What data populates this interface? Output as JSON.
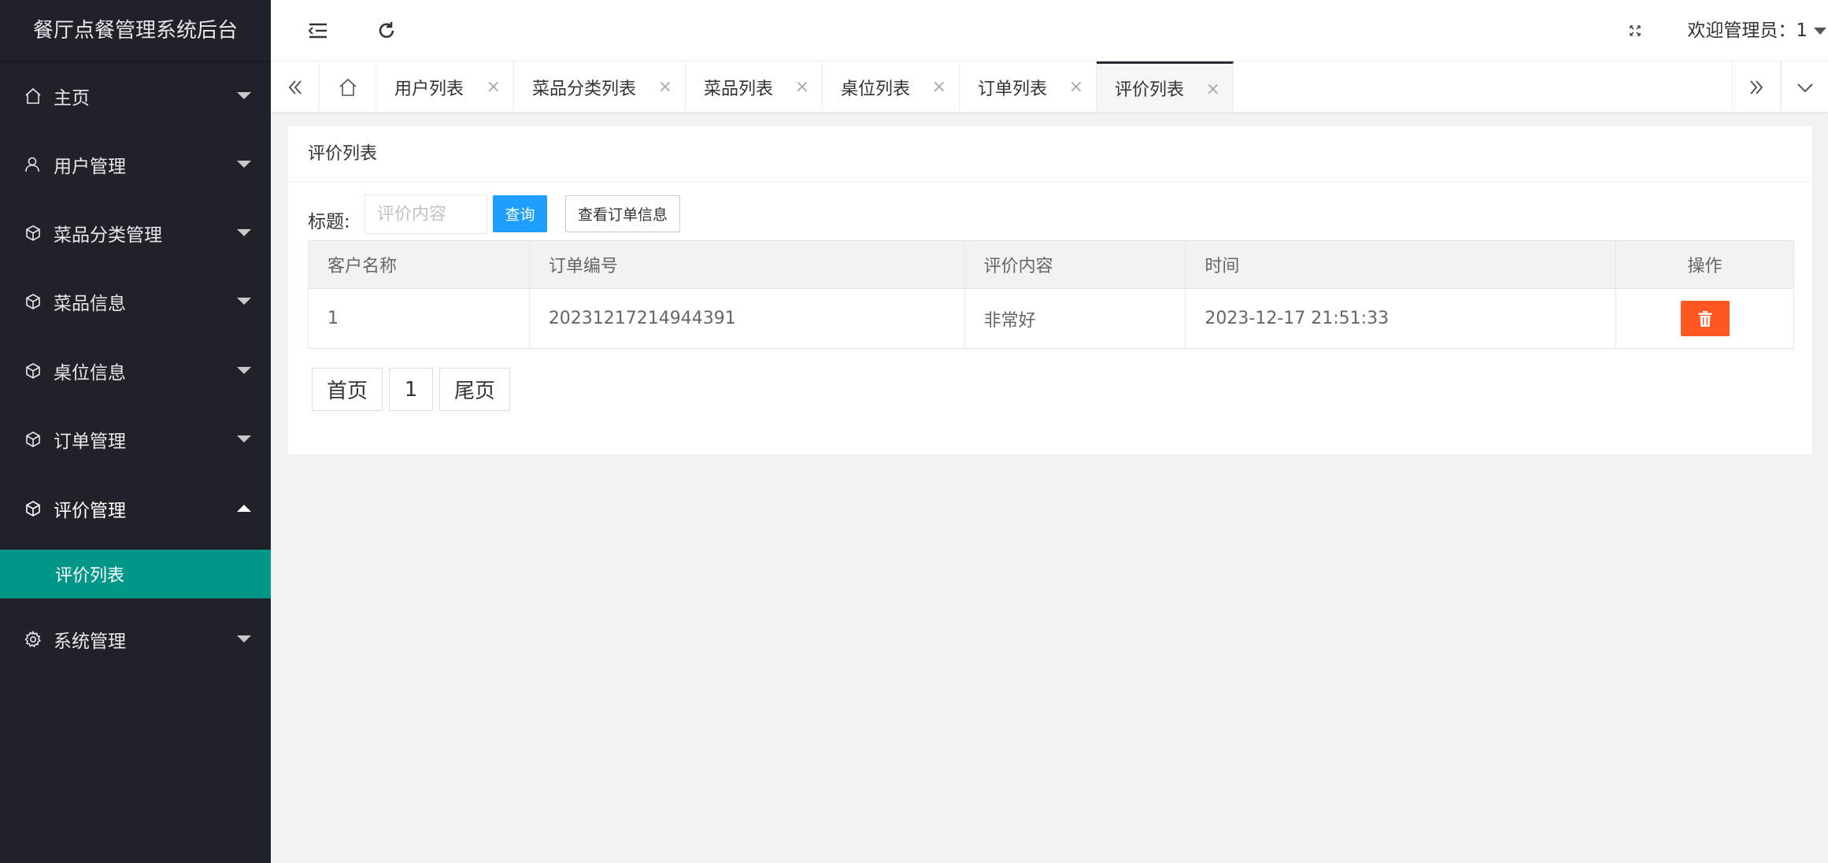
{
  "app": {
    "title": "餐厅点餐管理系统后台"
  },
  "sidebar": {
    "items": [
      {
        "label": "主页",
        "icon": "home-icon"
      },
      {
        "label": "用户管理",
        "icon": "user-icon"
      },
      {
        "label": "菜品分类管理",
        "icon": "cube-icon"
      },
      {
        "label": "菜品信息",
        "icon": "cube-icon"
      },
      {
        "label": "桌位信息",
        "icon": "cube-icon"
      },
      {
        "label": "订单管理",
        "icon": "cube-icon"
      },
      {
        "label": "评价管理",
        "icon": "cube-icon",
        "expanded": true
      },
      {
        "label": "系统管理",
        "icon": "gear-icon"
      }
    ],
    "active_sub_item": "评价列表"
  },
  "header": {
    "welcome": "欢迎管理员：1"
  },
  "tabs": [
    {
      "label": "用户列表"
    },
    {
      "label": "菜品分类列表"
    },
    {
      "label": "菜品列表"
    },
    {
      "label": "桌位列表"
    },
    {
      "label": "订单列表"
    },
    {
      "label": "评价列表",
      "active": true
    }
  ],
  "tab_close_glyph": "×",
  "card": {
    "title": "评价列表",
    "search": {
      "label": "标题:",
      "placeholder": "评价内容",
      "value": "",
      "query_button": "查询",
      "order_button": "查看订单信息"
    },
    "table": {
      "columns": [
        "客户名称",
        "订单编号",
        "评价内容",
        "时间",
        "操作"
      ],
      "rows": [
        [
          "1",
          "20231217214944391",
          "非常好",
          "2023-12-17 21:51:33"
        ]
      ]
    },
    "pager": {
      "first": "首页",
      "current": "1",
      "last": "尾页"
    }
  },
  "colors": {
    "sidebar_bg": "#20222a",
    "accent": "#009688",
    "primary_button": "#1e9fff",
    "danger_button": "#ff5722"
  }
}
